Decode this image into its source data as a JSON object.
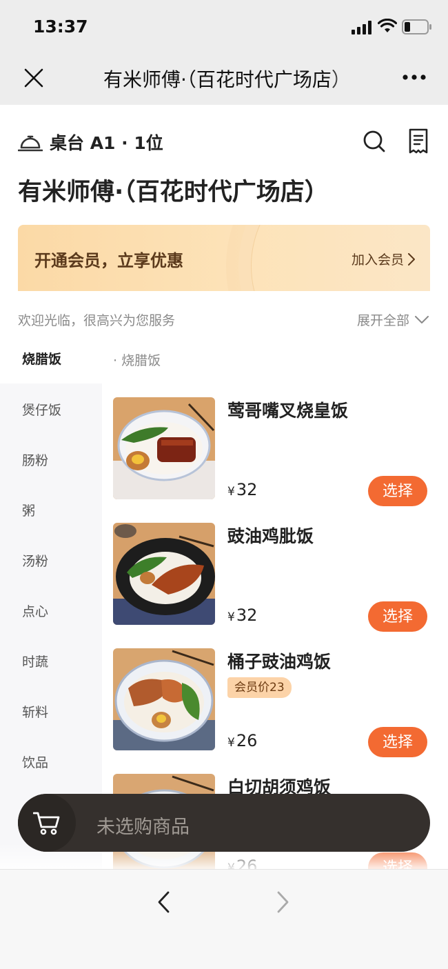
{
  "status_bar": {
    "time": "13:37"
  },
  "nav": {
    "title": "有米师傅·（百花时代广场店）"
  },
  "header": {
    "table_label": "桌台 A1 · 1位"
  },
  "shop": {
    "name": "有米师傅·（百花时代广场店）"
  },
  "membership": {
    "promo": "开通会员，立享优惠",
    "join": "加入会员"
  },
  "welcome": {
    "text": "欢迎光临，很高兴为您服务",
    "expand": "展开全部"
  },
  "categories": [
    "烧腊饭",
    "煲仔饭",
    "肠粉",
    "粥",
    "汤粉",
    "点心",
    "时蔬",
    "斩料",
    "饮品"
  ],
  "current_category_title": "· 烧腊饭",
  "dishes": [
    {
      "name": "莺哥嘴叉烧皇饭",
      "currency": "¥",
      "price": "32",
      "action": "选择",
      "member_price": ""
    },
    {
      "name": "豉油鸡肶饭",
      "currency": "¥",
      "price": "32",
      "action": "选择",
      "member_price": ""
    },
    {
      "name": "桶子豉油鸡饭",
      "currency": "¥",
      "price": "26",
      "action": "选择",
      "member_price": "会员价23"
    },
    {
      "name": "白切胡须鸡饭",
      "currency": "¥",
      "price": "26",
      "action": "选择",
      "member_price": ""
    }
  ],
  "cart": {
    "empty_text": "未选购商品"
  },
  "colors": {
    "accent": "#f36a32",
    "cart_bar": "#35302d",
    "member_bg": "#fde3b9"
  },
  "icons": [
    "close-icon",
    "more-icon",
    "service-bell-icon",
    "search-icon",
    "receipt-icon",
    "chevron-right-icon",
    "chevron-down-icon",
    "cart-icon",
    "back-arrow-icon",
    "forward-arrow-icon"
  ]
}
